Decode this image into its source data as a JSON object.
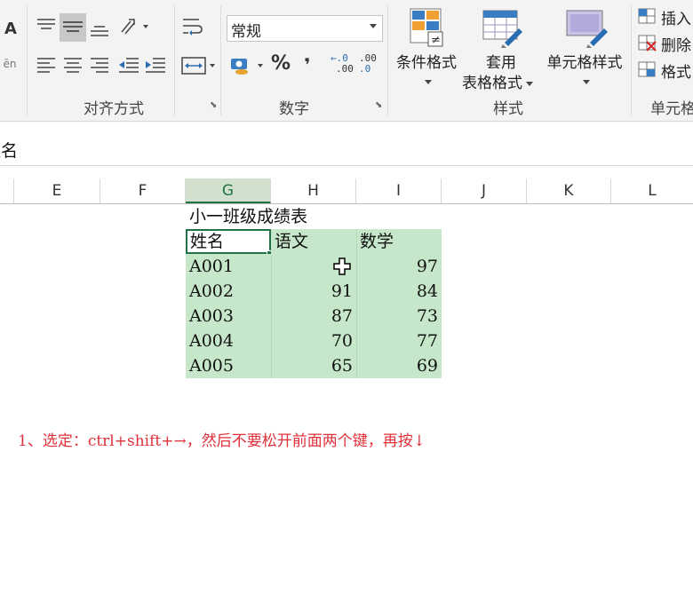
{
  "ribbon": {
    "font_partial_letter": "A",
    "align_group_label": "对齐方式",
    "number_group_label": "数字",
    "styles_group_label": "样式",
    "cells_group_label_partial": "单元格",
    "number_format": "常规",
    "percent_symbol": "%",
    "comma_symbol": "❜",
    "decimal_increase": ".00",
    "decimal_increase_top": "←.0",
    "decimal_decrease": ".0",
    "decimal_decrease_top": ".00",
    "conditional_format": "条件格式",
    "table_format_line1": "套用",
    "table_format_line2": "表格格式",
    "cell_style": "单元格样式",
    "insert": "插入",
    "delete": "删除",
    "format": "格式"
  },
  "formula_bar": {
    "value_partial": "姓名"
  },
  "columns": [
    "E",
    "F",
    "G",
    "H",
    "I",
    "J",
    "K",
    "L"
  ],
  "selected_column": "G",
  "sheet": {
    "title": "小一班级成绩表",
    "headers": [
      "姓名",
      "语文",
      "数学"
    ],
    "rows": [
      {
        "name": "A001",
        "chinese": "",
        "math": "97"
      },
      {
        "name": "A002",
        "chinese": "91",
        "math": "84"
      },
      {
        "name": "A003",
        "chinese": "87",
        "math": "73"
      },
      {
        "name": "A004",
        "chinese": "70",
        "math": "77"
      },
      {
        "name": "A005",
        "chinese": "65",
        "math": "69"
      }
    ]
  },
  "instruction": "1、选定：ctrl+shift+→，然后不要松开前面两个键，再按↓",
  "colors": {
    "selection": "#c6e7c9",
    "accent": "#217346",
    "annotation": "#e0303a"
  }
}
